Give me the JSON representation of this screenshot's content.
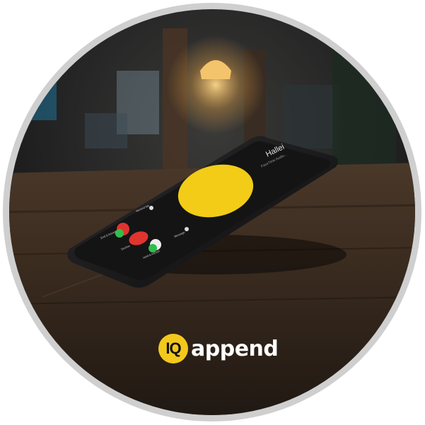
{
  "photo": {
    "description_free": true,
    "brand": {
      "mark": "IQ",
      "word": "append",
      "mark_color": "#f3c81d"
    },
    "phone_screen": {
      "caller_name": "Hallei",
      "call_status": "FaceTime Audio...",
      "actions": [
        "Remind Me",
        "Message"
      ],
      "buttons": [
        "End & Accept",
        "Decline",
        "Hold & Accept"
      ],
      "accent": "#f2cc17"
    },
    "colors": {
      "ring": "#c7c7c7",
      "table": "#3b2c20",
      "lamp": "#f4c46c"
    }
  }
}
